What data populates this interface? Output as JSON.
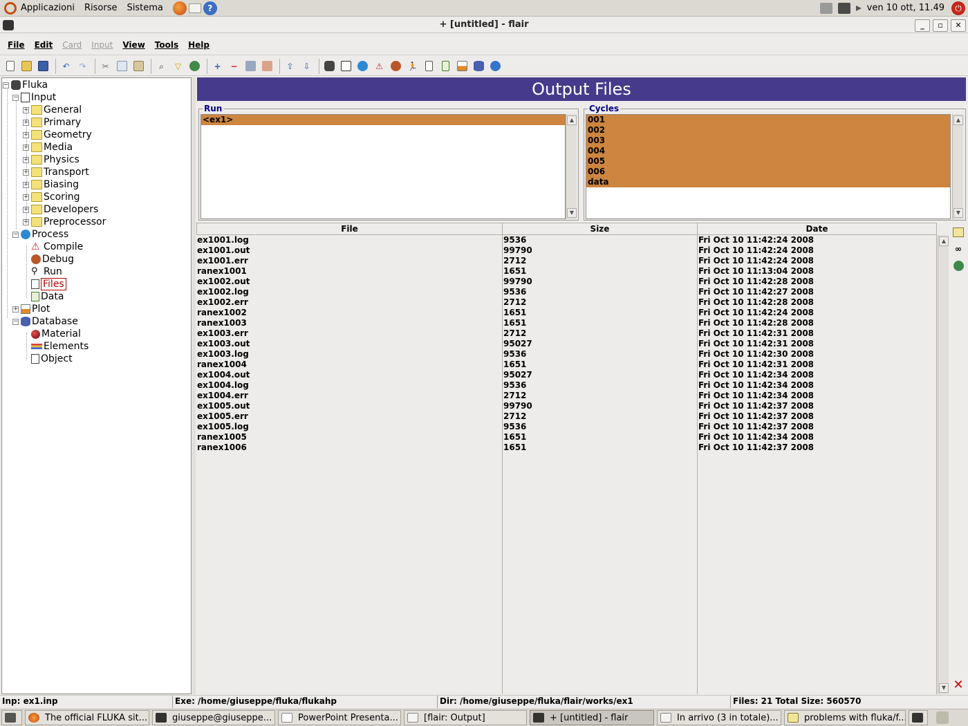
{
  "panel": {
    "menus": [
      "Applicazioni",
      "Risorse",
      "Sistema"
    ],
    "clock": "ven 10 ott, 11.49"
  },
  "window": {
    "title": "+ [untitled] - flair",
    "min": "_",
    "max": "▫",
    "close": "✕"
  },
  "menubar": {
    "file": "File",
    "edit": "Edit",
    "card": "Card",
    "input": "Input",
    "view": "View",
    "tools": "Tools",
    "help": "Help"
  },
  "toolbar_icons": [
    "new-icon",
    "open-icon",
    "save-icon",
    "undo-icon",
    "redo-icon",
    "cut-icon",
    "copy-icon",
    "paste-icon",
    "find-icon",
    "filter-icon",
    "globe-icon",
    "add-card-icon",
    "remove-card-icon",
    "clone-icon",
    "comment-icon",
    "move-up-icon",
    "move-down-icon",
    "fluka-icon",
    "input-icon",
    "process-icon",
    "compile-icon",
    "debug-icon",
    "run-icon",
    "files-icon",
    "data-icon",
    "plot-icon",
    "database-icon",
    "info-icon"
  ],
  "tree": {
    "root": "Fluka",
    "input": "Input",
    "input_children": [
      "General",
      "Primary",
      "Geometry",
      "Media",
      "Physics",
      "Transport",
      "Biasing",
      "Scoring",
      "Developers",
      "Preprocessor"
    ],
    "process": "Process",
    "compile": "Compile",
    "debug": "Debug",
    "run": "Run",
    "files": "Files",
    "data": "Data",
    "plot": "Plot",
    "database": "Database",
    "material": "Material",
    "elements": "Elements",
    "object": "Object"
  },
  "banner": "Output Files",
  "run_group": {
    "title": "Run",
    "items": [
      "<ex1>"
    ]
  },
  "cycles_group": {
    "title": "Cycles",
    "items": [
      "001",
      "002",
      "003",
      "004",
      "005",
      "006",
      "data"
    ]
  },
  "table": {
    "headers": {
      "file": "File",
      "size": "Size",
      "date": "Date"
    },
    "rows": [
      [
        "ex1001.log",
        "9536",
        "Fri Oct 10 11:42:24 2008"
      ],
      [
        "ex1001.out",
        "99790",
        "Fri Oct 10 11:42:24 2008"
      ],
      [
        "ex1001.err",
        "2712",
        "Fri Oct 10 11:42:24 2008"
      ],
      [
        "ranex1001",
        "1651",
        "Fri Oct 10 11:13:04 2008"
      ],
      [
        "ex1002.out",
        "99790",
        "Fri Oct 10 11:42:28 2008"
      ],
      [
        "ex1002.log",
        "9536",
        "Fri Oct 10 11:42:27 2008"
      ],
      [
        "ex1002.err",
        "2712",
        "Fri Oct 10 11:42:28 2008"
      ],
      [
        "ranex1002",
        "1651",
        "Fri Oct 10 11:42:24 2008"
      ],
      [
        "ranex1003",
        "1651",
        "Fri Oct 10 11:42:28 2008"
      ],
      [
        "ex1003.err",
        "2712",
        "Fri Oct 10 11:42:31 2008"
      ],
      [
        "ex1003.out",
        "95027",
        "Fri Oct 10 11:42:31 2008"
      ],
      [
        "ex1003.log",
        "9536",
        "Fri Oct 10 11:42:30 2008"
      ],
      [
        "ranex1004",
        "1651",
        "Fri Oct 10 11:42:31 2008"
      ],
      [
        "ex1004.out",
        "95027",
        "Fri Oct 10 11:42:34 2008"
      ],
      [
        "ex1004.log",
        "9536",
        "Fri Oct 10 11:42:34 2008"
      ],
      [
        "ex1004.err",
        "2712",
        "Fri Oct 10 11:42:34 2008"
      ],
      [
        "ex1005.out",
        "99790",
        "Fri Oct 10 11:42:37 2008"
      ],
      [
        "ex1005.err",
        "2712",
        "Fri Oct 10 11:42:37 2008"
      ],
      [
        "ex1005.log",
        "9536",
        "Fri Oct 10 11:42:37 2008"
      ],
      [
        "ranex1005",
        "1651",
        "Fri Oct 10 11:42:34 2008"
      ],
      [
        "ranex1006",
        "1651",
        "Fri Oct 10 11:42:37 2008"
      ]
    ]
  },
  "status": {
    "inp": "Inp: ex1.inp",
    "exe": "Exe: /home/giuseppe/fluka/flukahp",
    "dir": "Dir: /home/giuseppe/fluka/flair/works/ex1",
    "files": "Files: 21  Total Size: 560570"
  },
  "taskbar": [
    "The official FLUKA sit...",
    "giuseppe@giuseppe...",
    "PowerPoint Presenta...",
    "[flair: Output]",
    "+ [untitled] - flair",
    "In arrivo (3 in totale)...",
    "problems with fluka/f..."
  ],
  "colors": {
    "banner": "#463a8c",
    "selection": "#cd853f",
    "group_title": "#00008b"
  }
}
